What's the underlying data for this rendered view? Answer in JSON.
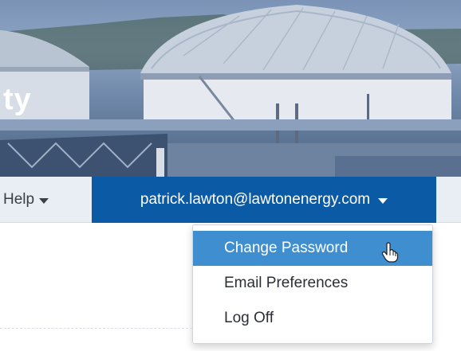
{
  "hero": {
    "title": "ty"
  },
  "navbar": {
    "help_label": "Help",
    "user_email": "patrick.lawton@lawtonenergy.com"
  },
  "user_menu": {
    "items": [
      {
        "label": "Change Password",
        "active": true
      },
      {
        "label": "Email Preferences",
        "active": false
      },
      {
        "label": "Log Off",
        "active": false
      }
    ]
  },
  "colors": {
    "navbar_bg": "#e9edf4",
    "user_button_bg": "#0a5aa6",
    "menu_active_bg": "#3e8ed0"
  },
  "icons": {
    "dropdown_caret": "chevron-down-icon",
    "cursor": "hand-pointer-icon"
  }
}
